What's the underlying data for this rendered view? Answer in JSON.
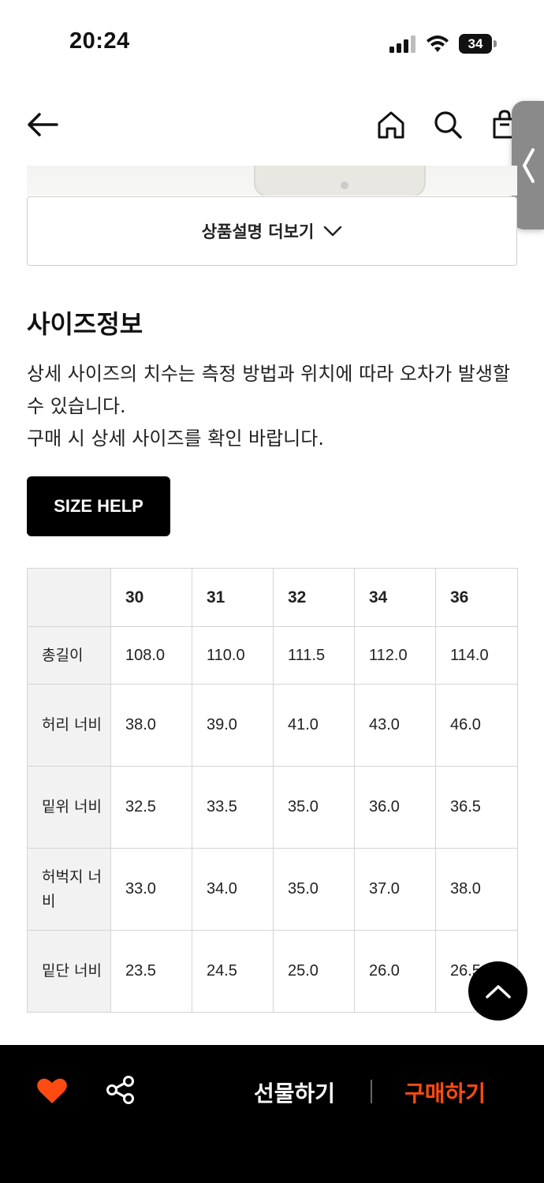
{
  "status_bar": {
    "time": "20:24",
    "battery": "34"
  },
  "nav": {
    "back_icon": "arrow-left-icon",
    "home_icon": "home-icon",
    "search_icon": "search-icon",
    "cart_icon": "shopping-bag-icon"
  },
  "side_tab": {
    "icon": "chevron-left-icon"
  },
  "product": {
    "more_label": "상품설명 더보기"
  },
  "size_info": {
    "title": "사이즈정보",
    "desc_line1": "상세 사이즈의 치수는 측정 방법과 위치에 따라 오차가 발생할 수 있습니다.",
    "desc_line2": "구매 시 상세 사이즈를 확인 바랍니다.",
    "help_button": "SIZE HELP"
  },
  "size_table": {
    "headers": [
      "",
      "30",
      "31",
      "32",
      "34",
      "36"
    ],
    "rows": [
      {
        "label": "총길이",
        "values": [
          "108.0",
          "110.0",
          "111.5",
          "112.0",
          "114.0"
        ]
      },
      {
        "label": "허리 너비",
        "values": [
          "38.0",
          "39.0",
          "41.0",
          "43.0",
          "46.0"
        ]
      },
      {
        "label": "밑위 너비",
        "values": [
          "32.5",
          "33.5",
          "35.0",
          "36.0",
          "36.5"
        ]
      },
      {
        "label": "허벅지 너비",
        "values": [
          "33.0",
          "34.0",
          "35.0",
          "37.0",
          "38.0"
        ]
      },
      {
        "label": "밑단 너비",
        "values": [
          "23.5",
          "24.5",
          "25.0",
          "26.0",
          "26.5"
        ]
      }
    ]
  },
  "bottom_bar": {
    "gift_label": "선물하기",
    "buy_label": "구매하기",
    "accent_color": "#ff4b12",
    "heart_color": "#ff4b12"
  }
}
